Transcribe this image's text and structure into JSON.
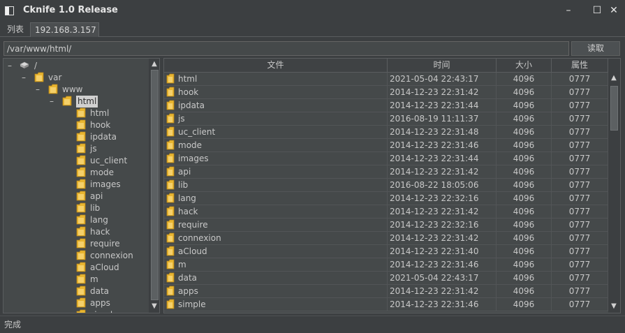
{
  "window": {
    "title": "Cknife 1.0 Release",
    "controls": {
      "minimize": "–",
      "maximize": "☐",
      "close": "✕"
    }
  },
  "tabs": [
    {
      "label": "列表"
    },
    {
      "label": "192.168.3.157"
    }
  ],
  "path": {
    "value": "/var/www/html/",
    "read_label": "读取"
  },
  "tree": {
    "root": "/",
    "var": "var",
    "www": "www",
    "html": "html",
    "children": [
      "html",
      "hook",
      "ipdata",
      "js",
      "uc_client",
      "mode",
      "images",
      "api",
      "lib",
      "lang",
      "hack",
      "require",
      "connexion",
      "aCloud",
      "m",
      "data",
      "apps",
      "simple"
    ]
  },
  "table": {
    "headers": {
      "name": "文件",
      "time": "时间",
      "size": "大小",
      "attr": "属性"
    },
    "rows": [
      {
        "name": "html",
        "time": "2021-05-04 22:43:17",
        "size": "4096",
        "attr": "0777"
      },
      {
        "name": "hook",
        "time": "2014-12-23 22:31:42",
        "size": "4096",
        "attr": "0777"
      },
      {
        "name": "ipdata",
        "time": "2014-12-23 22:31:44",
        "size": "4096",
        "attr": "0777"
      },
      {
        "name": "js",
        "time": "2016-08-19 11:11:37",
        "size": "4096",
        "attr": "0777"
      },
      {
        "name": "uc_client",
        "time": "2014-12-23 22:31:48",
        "size": "4096",
        "attr": "0777"
      },
      {
        "name": "mode",
        "time": "2014-12-23 22:31:46",
        "size": "4096",
        "attr": "0777"
      },
      {
        "name": "images",
        "time": "2014-12-23 22:31:44",
        "size": "4096",
        "attr": "0777"
      },
      {
        "name": "api",
        "time": "2014-12-23 22:31:42",
        "size": "4096",
        "attr": "0777"
      },
      {
        "name": "lib",
        "time": "2016-08-22 18:05:06",
        "size": "4096",
        "attr": "0777"
      },
      {
        "name": "lang",
        "time": "2014-12-23 22:32:16",
        "size": "4096",
        "attr": "0777"
      },
      {
        "name": "hack",
        "time": "2014-12-23 22:31:42",
        "size": "4096",
        "attr": "0777"
      },
      {
        "name": "require",
        "time": "2014-12-23 22:32:16",
        "size": "4096",
        "attr": "0777"
      },
      {
        "name": "connexion",
        "time": "2014-12-23 22:31:42",
        "size": "4096",
        "attr": "0777"
      },
      {
        "name": "aCloud",
        "time": "2014-12-23 22:31:40",
        "size": "4096",
        "attr": "0777"
      },
      {
        "name": "m",
        "time": "2014-12-23 22:31:46",
        "size": "4096",
        "attr": "0777"
      },
      {
        "name": "data",
        "time": "2021-05-04 22:43:17",
        "size": "4096",
        "attr": "0777"
      },
      {
        "name": "apps",
        "time": "2014-12-23 22:31:42",
        "size": "4096",
        "attr": "0777"
      },
      {
        "name": "simple",
        "time": "2014-12-23 22:31:46",
        "size": "4096",
        "attr": "0777"
      }
    ]
  },
  "status": {
    "text": "完成"
  },
  "colors": {
    "background": "#3c3f41",
    "panel": "#45494a",
    "folder": "#e8b530",
    "text": "#c8c8c8"
  },
  "icons": {
    "folder": "folder-icon",
    "drive": "drive-icon",
    "scroll_up": "▲",
    "scroll_down": "▼"
  }
}
